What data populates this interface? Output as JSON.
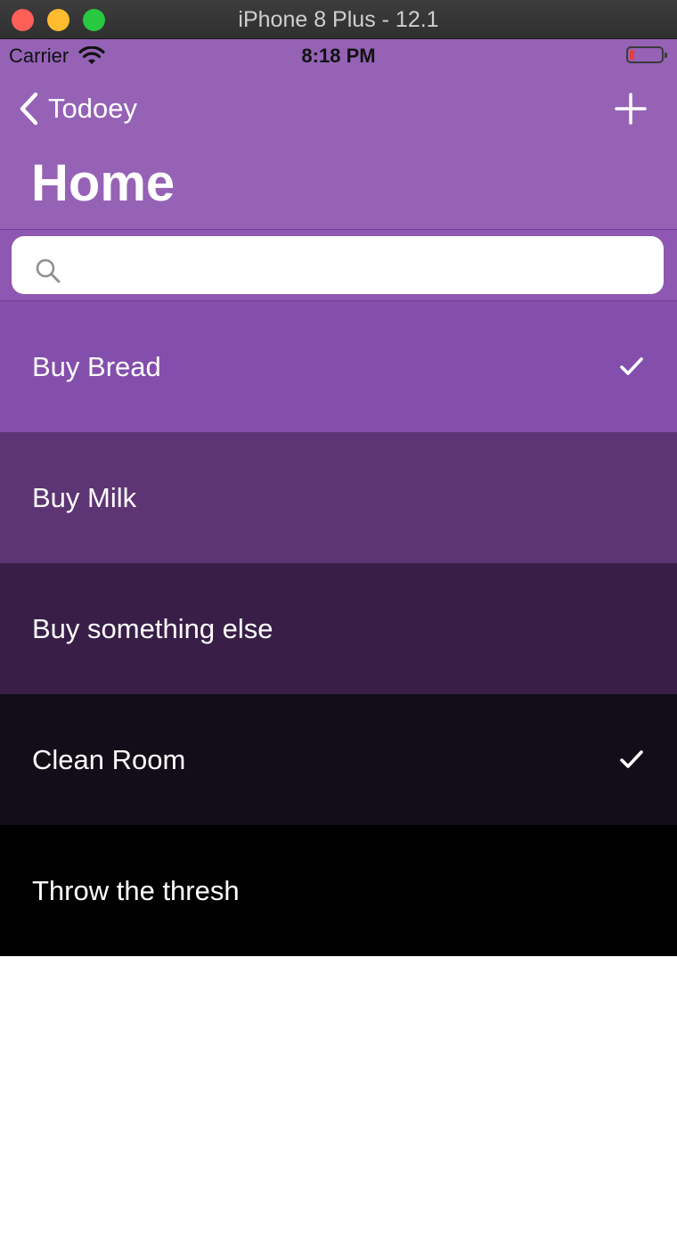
{
  "window": {
    "title": "iPhone 8 Plus - 12.1"
  },
  "status_bar": {
    "carrier": "Carrier",
    "time": "8:18 PM",
    "wifi_icon": "wifi-icon",
    "battery_icon": "battery-icon",
    "battery_color": "#e5403b"
  },
  "nav": {
    "back_label": "Todoey",
    "back_icon": "chevron-left-icon",
    "add_icon": "plus-icon",
    "title": "Home",
    "bar_color": "#9562b6"
  },
  "search": {
    "placeholder": "",
    "value": "",
    "icon": "search-icon"
  },
  "items": [
    {
      "label": "Buy Bread",
      "done": true,
      "color": "#834eac"
    },
    {
      "label": "Buy Milk",
      "done": false,
      "color": "#5d3474"
    },
    {
      "label": "Buy something else",
      "done": false,
      "color": "#391f48"
    },
    {
      "label": "Clean Room",
      "done": true,
      "color": "#120d19"
    },
    {
      "label": "Throw the thresh",
      "done": false,
      "color": "#000000"
    }
  ]
}
